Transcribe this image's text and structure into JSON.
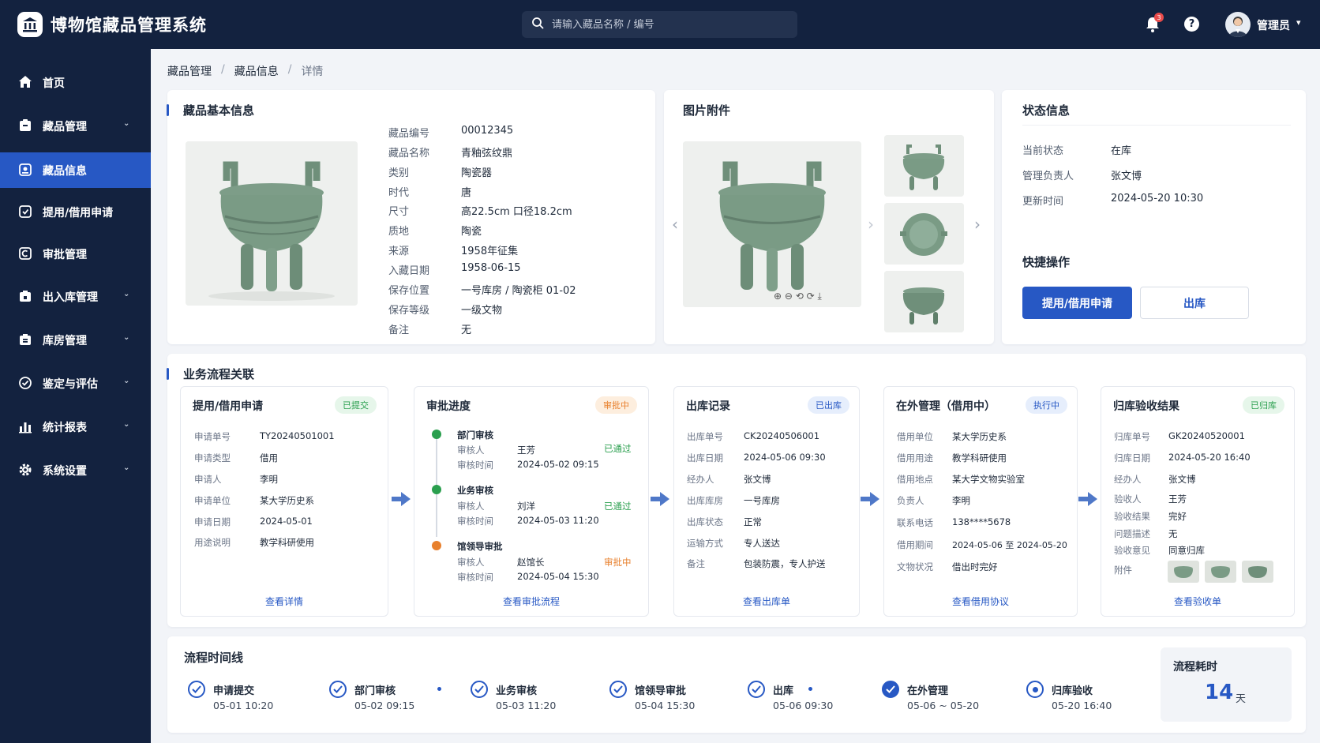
{
  "header": {
    "app_title": "博物馆藏品管理系统",
    "search_placeholder": "请输入藏品名称 / 编号",
    "notifications": "3",
    "help": "?",
    "user_name": "管理员"
  },
  "sidebar": {
    "items": [
      {
        "label": "首页",
        "icon": "home-icon"
      },
      {
        "label": "藏品管理",
        "icon": "archive-icon",
        "chevron": true
      },
      {
        "label": "藏品信息",
        "icon": "collection-icon",
        "active": true
      },
      {
        "label": "提用/借用申请",
        "icon": "request-icon"
      },
      {
        "label": "审批管理",
        "icon": "approval-icon"
      },
      {
        "label": "出入库管理",
        "icon": "inout-icon",
        "chevron": true
      },
      {
        "label": "库房管理",
        "icon": "warehouse-icon",
        "chevron": true
      },
      {
        "label": "鉴定与评估",
        "icon": "appraisal-icon",
        "chevron": true
      },
      {
        "label": "统计报表",
        "icon": "chart-icon",
        "chevron": true
      },
      {
        "label": "系统设置",
        "icon": "gear-icon",
        "chevron": true
      }
    ]
  },
  "breadcrumb": {
    "items": [
      "藏品管理",
      "藏品信息",
      "详情"
    ],
    "sep": "/"
  },
  "basic": {
    "title": "藏品基本信息",
    "fields": [
      {
        "label": "藏品编号",
        "value": "00012345"
      },
      {
        "label": "藏品名称",
        "value": "青釉弦纹鼎"
      },
      {
        "label": "类别",
        "value": "陶瓷器"
      },
      {
        "label": "时代",
        "value": "唐"
      },
      {
        "label": "尺寸",
        "value": "高22.5cm 口径18.2cm"
      },
      {
        "label": "质地",
        "value": "陶瓷"
      },
      {
        "label": "来源",
        "value": "1958年征集"
      },
      {
        "label": "入藏日期",
        "value": "1958-06-15"
      },
      {
        "label": "保存位置",
        "value": "一号库房 / 陶瓷柜 01-02"
      },
      {
        "label": "保存等级",
        "value": "一级文物"
      },
      {
        "label": "备注",
        "value": "无"
      }
    ]
  },
  "attachments": {
    "title": "图片附件",
    "prev": "‹",
    "next": "›",
    "inner_next": "›"
  },
  "status": {
    "title": "状态信息",
    "fields": [
      {
        "label": "当前状态",
        "value": "在库"
      },
      {
        "label": "管理负责人",
        "value": "张文博"
      },
      {
        "label": "更新时间",
        "value": "2024-05-20 10:30"
      }
    ],
    "quick_title": "快捷操作",
    "btn_request": "提用/借用申请",
    "btn_out": "出库"
  },
  "flow": {
    "title": "业务流程关联",
    "cards": [
      {
        "title": "提用/借用申请",
        "tag": "已提交",
        "fields": [
          [
            "申请单号",
            "TY20240501001"
          ],
          [
            "申请类型",
            "借用"
          ],
          [
            "申请人",
            "李明"
          ],
          [
            "申请单位",
            "某大学历史系"
          ],
          [
            "申请日期",
            "2024-05-01"
          ],
          [
            "用途说明",
            "教学科研使用"
          ]
        ],
        "link": "查看详情"
      },
      {
        "title": "审批进度",
        "tag": "审批中",
        "steps": [
          {
            "name": "部门审核",
            "reviewer_label": "审核人",
            "reviewer": "王芳",
            "time_label": "审核时间",
            "time": "2024-05-02 09:15",
            "status": "已通过"
          },
          {
            "name": "业务审核",
            "reviewer_label": "审核人",
            "reviewer": "刘洋",
            "time_label": "审核时间",
            "time": "2024-05-03 11:20",
            "status": "已通过"
          },
          {
            "name": "馆领导审批",
            "reviewer_label": "审核人",
            "reviewer": "赵馆长",
            "time_label": "审核时间",
            "time": "2024-05-04 15:30",
            "status": "审批中"
          }
        ],
        "link": "查看审批流程"
      },
      {
        "title": "出库记录",
        "tag": "已出库",
        "fields": [
          [
            "出库单号",
            "CK20240506001"
          ],
          [
            "出库日期",
            "2024-05-06 09:30"
          ],
          [
            "经办人",
            "张文博"
          ],
          [
            "出库库房",
            "一号库房"
          ],
          [
            "出库状态",
            "正常"
          ],
          [
            "运输方式",
            "专人送达"
          ],
          [
            "备注",
            "包装防震，专人护送"
          ]
        ],
        "link": "查看出库单"
      },
      {
        "title": "在外管理（借用中）",
        "tag": "执行中",
        "fields": [
          [
            "借用单位",
            "某大学历史系"
          ],
          [
            "借用用途",
            "教学科研使用"
          ],
          [
            "借用地点",
            "某大学文物实验室"
          ],
          [
            "负责人",
            "李明"
          ],
          [
            "联系电话",
            "138****5678"
          ],
          [
            "借用期间",
            "2024-05-06 至 2024-05-20"
          ],
          [
            "文物状况",
            "借出时完好"
          ]
        ],
        "link": "查看借用协议"
      },
      {
        "title": "归库验收结果",
        "tag": "已归库",
        "fields": [
          [
            "归库单号",
            "GK20240520001"
          ],
          [
            "归库日期",
            "2024-05-20 16:40"
          ],
          [
            "经办人",
            "张文博"
          ],
          [
            "验收人",
            "王芳"
          ],
          [
            "验收结果",
            "完好"
          ],
          [
            "问题描述",
            "无"
          ],
          [
            "验收意见",
            "同意归库"
          ],
          [
            "附件",
            ""
          ]
        ],
        "link": "查看验收单"
      }
    ]
  },
  "timeline": {
    "title": "流程时间线",
    "items": [
      {
        "label": "申请提交",
        "date": "05-01 10:20"
      },
      {
        "label": "部门审核",
        "date": "05-02 09:15"
      },
      {
        "label": "业务审核",
        "date": "05-03 11:20"
      },
      {
        "label": "馆领导审批",
        "date": "05-04 15:30"
      },
      {
        "label": "出库",
        "date": "05-06 09:30"
      },
      {
        "label": "在外管理",
        "date": "05-06 ~ 05-20"
      },
      {
        "label": "归库验收",
        "date": "05-20 16:40"
      }
    ],
    "total_label": "流程耗时",
    "total_value": "14",
    "total_unit": "天"
  },
  "colors": {
    "brand": "#2758c4",
    "nav_bg": "#13223f",
    "success": "#2a9f4e",
    "warning": "#e8802d"
  }
}
